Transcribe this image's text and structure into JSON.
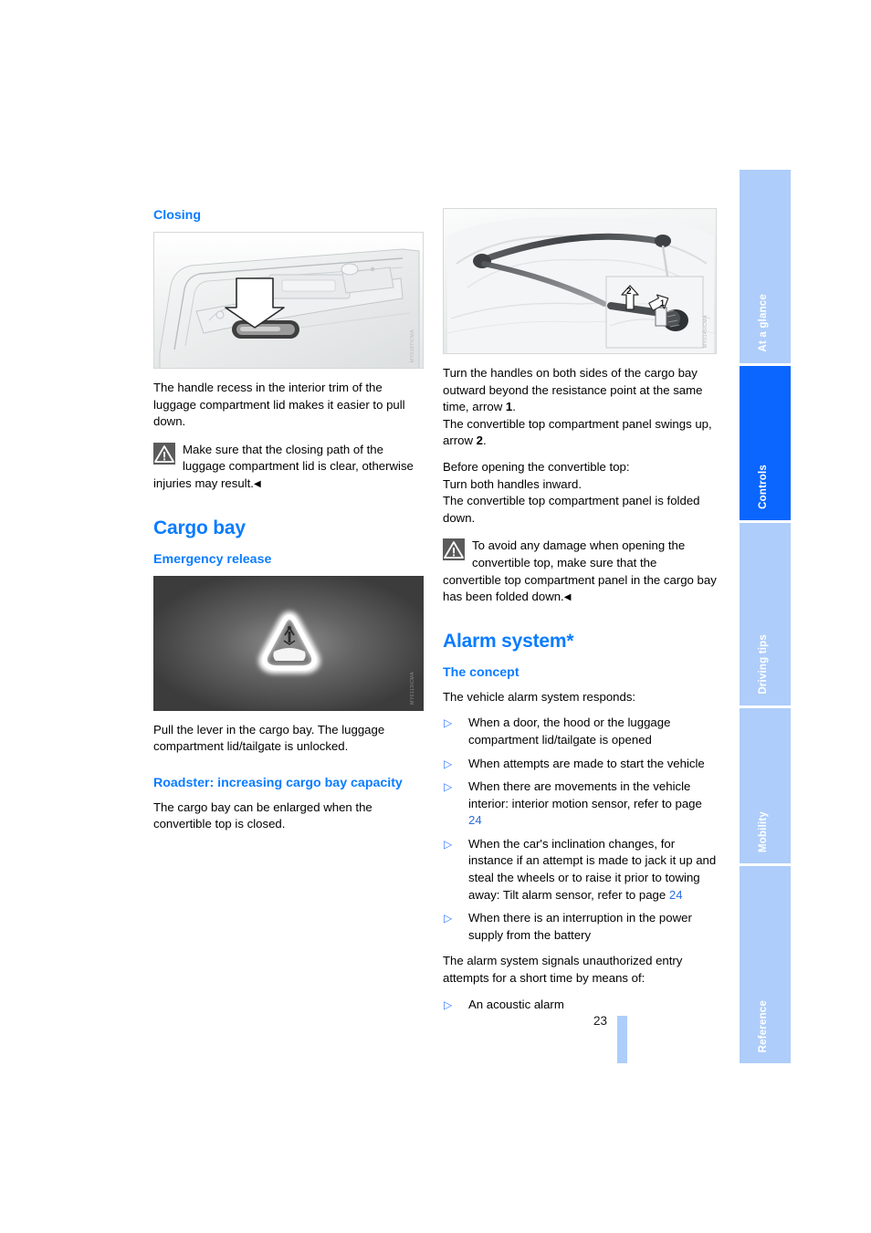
{
  "page": {
    "number": "23"
  },
  "left_column": {
    "closing": {
      "heading": "Closing",
      "figure_watermark": "MY0187ICMA",
      "body": "The handle recess in the interior trim of the luggage compartment lid makes it easier to pull down.",
      "warning": "Make sure that the closing path of the luggage compartment lid is clear, otherwise injuries may result.",
      "warning_end_mark": "◀"
    },
    "cargo_bay": {
      "heading": "Cargo bay",
      "emergency_release": {
        "heading": "Emergency release",
        "figure_watermark": "MY0113ICMA",
        "body": "Pull the lever in the cargo bay. The luggage compartment lid/tailgate is unlocked."
      },
      "roadster": {
        "heading": "Roadster: increasing cargo bay capacity",
        "body": "The cargo bay can be enlarged when the convertible top is closed."
      }
    }
  },
  "right_column": {
    "handles_figure": {
      "watermark": "MY0145ICMA",
      "callout_1": "1",
      "callout_2": "2"
    },
    "handles_text": {
      "para1_a": "Turn the handles on both sides of the cargo bay outward beyond the resistance point at the same time, arrow ",
      "para1_num": "1",
      "para1_b": ".",
      "para2_a": "The convertible top compartment panel swings up, arrow ",
      "para2_num": "2",
      "para2_b": ".",
      "para3": "Before opening the convertible top:\nTurn both handles inward.\nThe convertible top compartment panel is folded down.",
      "warning": "To avoid any damage when opening the convertible top, make sure that the convertible top compartment panel in the cargo bay has been folded down.",
      "warning_end_mark": "◀"
    },
    "alarm_system": {
      "heading": "Alarm system*",
      "concept": {
        "heading": "The concept",
        "intro": "The vehicle alarm system responds:",
        "items": [
          {
            "text": "When a door, the hood or the luggage compartment lid/tailgate is opened"
          },
          {
            "text": "When attempts are made to start the vehicle"
          },
          {
            "text": "When there are movements in the vehicle interior: interior motion sensor, refer to page ",
            "page_ref": "24"
          },
          {
            "text": "When the car's inclination changes, for instance if an attempt is made to jack it up and steal the wheels or to raise it prior to towing away: Tilt alarm sensor, refer to page ",
            "page_ref": "24"
          },
          {
            "text": "When there is an interruption in the power supply from the battery"
          }
        ],
        "signals_intro": "The alarm system signals unauthorized entry attempts for a short time by means of:",
        "signals": [
          {
            "text": "An acoustic alarm"
          }
        ]
      }
    }
  },
  "sidebar": {
    "tabs": [
      {
        "label": "At a glance",
        "active": false
      },
      {
        "label": "Controls",
        "active": true
      },
      {
        "label": "Driving tips",
        "active": false
      },
      {
        "label": "Mobility",
        "active": false
      },
      {
        "label": "Reference",
        "active": false
      }
    ]
  },
  "colors": {
    "heading_blue": "#0a7cff",
    "tab_inactive": "#aecdfa",
    "tab_active": "#0a66ff",
    "page_ref": "#2b6fe0"
  },
  "icons": {
    "warning": "warning-triangle-icon",
    "bullet": "triangle-right-bullet-icon"
  }
}
